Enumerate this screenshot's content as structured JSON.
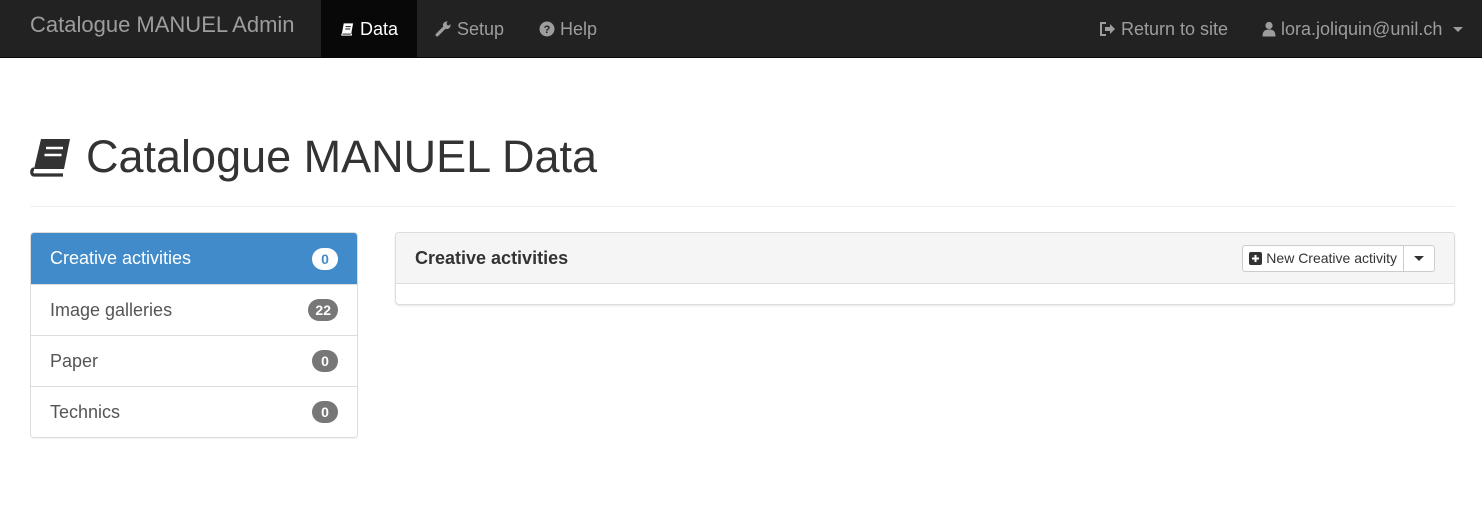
{
  "navbar": {
    "brand": "Catalogue MANUEL Admin",
    "items": [
      {
        "label": "Data",
        "icon": "book-icon",
        "active": true
      },
      {
        "label": "Setup",
        "icon": "wrench-icon"
      },
      {
        "label": "Help",
        "icon": "question-circle-icon"
      }
    ],
    "right": {
      "return_label": "Return to site",
      "return_icon": "sign-out-icon",
      "user_label": "lora.joliquin@unil.ch",
      "user_icon": "user-icon"
    }
  },
  "page": {
    "title": "Catalogue MANUEL Data",
    "title_icon": "book-icon"
  },
  "sidebar": {
    "items": [
      {
        "label": "Creative activities",
        "count": "0",
        "active": true
      },
      {
        "label": "Image galleries",
        "count": "22"
      },
      {
        "label": "Paper",
        "count": "0"
      },
      {
        "label": "Technics",
        "count": "0"
      }
    ]
  },
  "panel": {
    "title": "Creative activities",
    "new_button_label": "New Creative activity",
    "new_button_icon": "plus-square-icon"
  },
  "colors": {
    "navbar_bg": "#222222",
    "active_nav_bg": "#080808",
    "active_list_bg": "#428bca",
    "badge_bg": "#777777"
  }
}
